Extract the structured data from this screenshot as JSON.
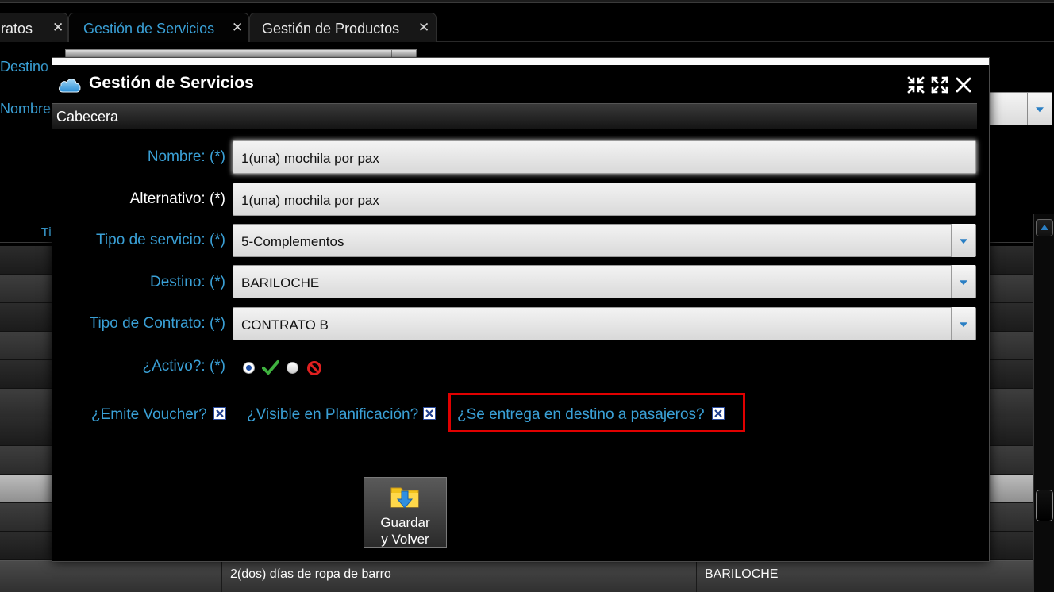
{
  "tabs": [
    {
      "label": "ratos",
      "active": false
    },
    {
      "label": "Gestión de Servicios",
      "active": true
    },
    {
      "label": "Gestión de Productos",
      "active": false
    }
  ],
  "tab_close_glyph": "✕",
  "background": {
    "destino_label": "Destino",
    "nombre_label": "Nombre",
    "grid_header_fragment": "Ti",
    "last_row": {
      "nombre": "2(dos) días de ropa de barro",
      "destino": "BARILOCHE"
    }
  },
  "modal": {
    "title": "Gestión de Servicios",
    "icon": "cloud-icon",
    "section_title": "Cabecera",
    "fields": {
      "nombre": {
        "label": "Nombre: (*)",
        "value": "1(una) mochila por pax"
      },
      "alternativo": {
        "label": "Alternativo: (*)",
        "value": "1(una) mochila por pax"
      },
      "tipo_servicio": {
        "label": "Tipo de servicio: (*)",
        "value": "5-Complementos"
      },
      "destino": {
        "label": "Destino: (*)",
        "value": "BARILOCHE"
      },
      "tipo_contrato": {
        "label": "Tipo de Contrato: (*)",
        "value": "CONTRATO B"
      },
      "activo": {
        "label": "¿Activo?: (*)",
        "selected": "si"
      }
    },
    "checkboxes": {
      "emite_voucher": {
        "label": "¿Emite Voucher?",
        "checked": true
      },
      "visible_planificacion": {
        "label": "¿Visible en Planificación?",
        "checked": true
      },
      "entrega_destino": {
        "label": "¿Se entrega en destino a pasajeros?",
        "checked": true
      }
    },
    "save_button": {
      "line1": "Guardar",
      "line2": "y Volver"
    }
  },
  "colors": {
    "accent": "#3aa0d6",
    "highlight": "#e00000"
  }
}
